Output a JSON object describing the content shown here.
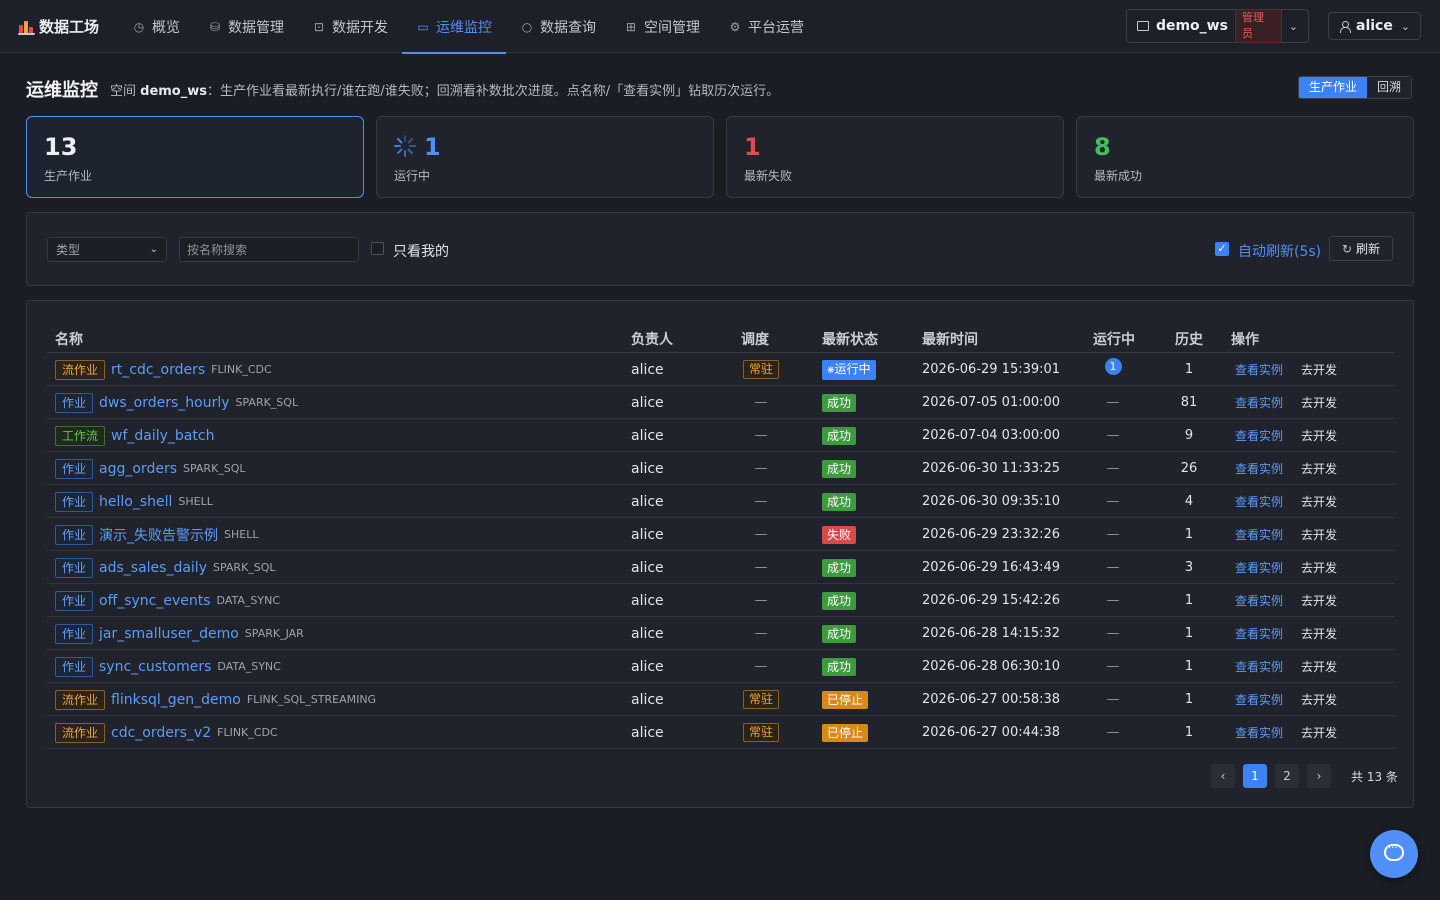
{
  "app": {
    "brand": "数据工场"
  },
  "nav": [
    {
      "label": "概览",
      "icon": "dashboard-icon",
      "glyph": "◷"
    },
    {
      "label": "数据管理",
      "icon": "database-icon",
      "glyph": "⛁"
    },
    {
      "label": "数据开发",
      "icon": "code-icon",
      "glyph": "⊡"
    },
    {
      "label": "运维监控",
      "icon": "monitor-icon",
      "glyph": "▭",
      "active": true
    },
    {
      "label": "数据查询",
      "icon": "search-icon",
      "glyph": "○"
    },
    {
      "label": "空间管理",
      "icon": "building-icon",
      "glyph": "⊞"
    },
    {
      "label": "平台运营",
      "icon": "gear-icon",
      "glyph": "⚙"
    }
  ],
  "workspace": {
    "name": "demo_ws",
    "role": "管理员"
  },
  "user": {
    "name": "alice"
  },
  "header": {
    "title": "运维监控",
    "desc_prefix": "空间 ",
    "desc_ws": "demo_ws",
    "desc_rest": "：生产作业看最新执行/谁在跑/谁失败；回溯看补数批次进度。点名称/「查看实例」钻取历次运行。",
    "tabs": [
      "生产作业",
      "回溯"
    ]
  },
  "stats": [
    {
      "value": "13",
      "label": "生产作业",
      "color": "#eceef2",
      "selected": true
    },
    {
      "value": "1",
      "label": "运行中",
      "color": "#4f8ff7",
      "spinner": true
    },
    {
      "value": "1",
      "label": "最新失败",
      "color": "#e24b4b"
    },
    {
      "value": "8",
      "label": "最新成功",
      "color": "#3fbf5f"
    }
  ],
  "filters": {
    "type_placeholder": "类型",
    "search_placeholder": "按名称搜索",
    "mine_label": "只看我的",
    "auto_refresh_label": "自动刷新(5s)",
    "refresh_label": "刷新"
  },
  "table": {
    "columns": [
      "名称",
      "负责人",
      "调度",
      "最新状态",
      "最新时间",
      "运行中",
      "历史",
      "操作"
    ],
    "view_label": "查看实例",
    "dev_label": "去开发",
    "rows": [
      {
        "tag": "流作业",
        "kind": "stream",
        "name": "rt_cdc_orders",
        "type": "FLINK_CDC",
        "owner": "alice",
        "sched": "常驻",
        "status": "运行中",
        "state": "running",
        "time": "2026-06-29 15:39:01",
        "running": "1",
        "history": "1"
      },
      {
        "tag": "作业",
        "kind": "job",
        "name": "dws_orders_hourly",
        "type": "SPARK_SQL",
        "owner": "alice",
        "sched": "—",
        "status": "成功",
        "state": "success",
        "time": "2026-07-05 01:00:00",
        "running": "—",
        "history": "81"
      },
      {
        "tag": "工作流",
        "kind": "wf",
        "name": "wf_daily_batch",
        "type": "",
        "owner": "alice",
        "sched": "—",
        "status": "成功",
        "state": "success",
        "time": "2026-07-04 03:00:00",
        "running": "—",
        "history": "9"
      },
      {
        "tag": "作业",
        "kind": "job",
        "name": "agg_orders",
        "type": "SPARK_SQL",
        "owner": "alice",
        "sched": "—",
        "status": "成功",
        "state": "success",
        "time": "2026-06-30 11:33:25",
        "running": "—",
        "history": "26"
      },
      {
        "tag": "作业",
        "kind": "job",
        "name": "hello_shell",
        "type": "SHELL",
        "owner": "alice",
        "sched": "—",
        "status": "成功",
        "state": "success",
        "time": "2026-06-30 09:35:10",
        "running": "—",
        "history": "4"
      },
      {
        "tag": "作业",
        "kind": "job",
        "name": "演示_失败告警示例",
        "type": "SHELL",
        "owner": "alice",
        "sched": "—",
        "status": "失败",
        "state": "fail",
        "time": "2026-06-29 23:32:26",
        "running": "—",
        "history": "1"
      },
      {
        "tag": "作业",
        "kind": "job",
        "name": "ads_sales_daily",
        "type": "SPARK_SQL",
        "owner": "alice",
        "sched": "—",
        "status": "成功",
        "state": "success",
        "time": "2026-06-29 16:43:49",
        "running": "—",
        "history": "3"
      },
      {
        "tag": "作业",
        "kind": "job",
        "name": "off_sync_events",
        "type": "DATA_SYNC",
        "owner": "alice",
        "sched": "—",
        "status": "成功",
        "state": "success",
        "time": "2026-06-29 15:42:26",
        "running": "—",
        "history": "1"
      },
      {
        "tag": "作业",
        "kind": "job",
        "name": "jar_smalluser_demo",
        "type": "SPARK_JAR",
        "owner": "alice",
        "sched": "—",
        "status": "成功",
        "state": "success",
        "time": "2026-06-28 14:15:32",
        "running": "—",
        "history": "1"
      },
      {
        "tag": "作业",
        "kind": "job",
        "name": "sync_customers",
        "type": "DATA_SYNC",
        "owner": "alice",
        "sched": "—",
        "status": "成功",
        "state": "success",
        "time": "2026-06-28 06:30:10",
        "running": "—",
        "history": "1"
      },
      {
        "tag": "流作业",
        "kind": "stream",
        "name": "flinksql_gen_demo",
        "type": "FLINK_SQL_STREAMING",
        "owner": "alice",
        "sched": "常驻",
        "status": "已停止",
        "state": "stopped",
        "time": "2026-06-27 00:58:38",
        "running": "—",
        "history": "1"
      },
      {
        "tag": "流作业",
        "kind": "stream",
        "name": "cdc_orders_v2",
        "type": "FLINK_CDC",
        "owner": "alice",
        "sched": "常驻",
        "status": "已停止",
        "state": "stopped",
        "time": "2026-06-27 00:44:38",
        "running": "—",
        "history": "1"
      }
    ]
  },
  "pagination": {
    "pages": [
      "1",
      "2"
    ],
    "current": "1",
    "total": "共 13 条"
  }
}
